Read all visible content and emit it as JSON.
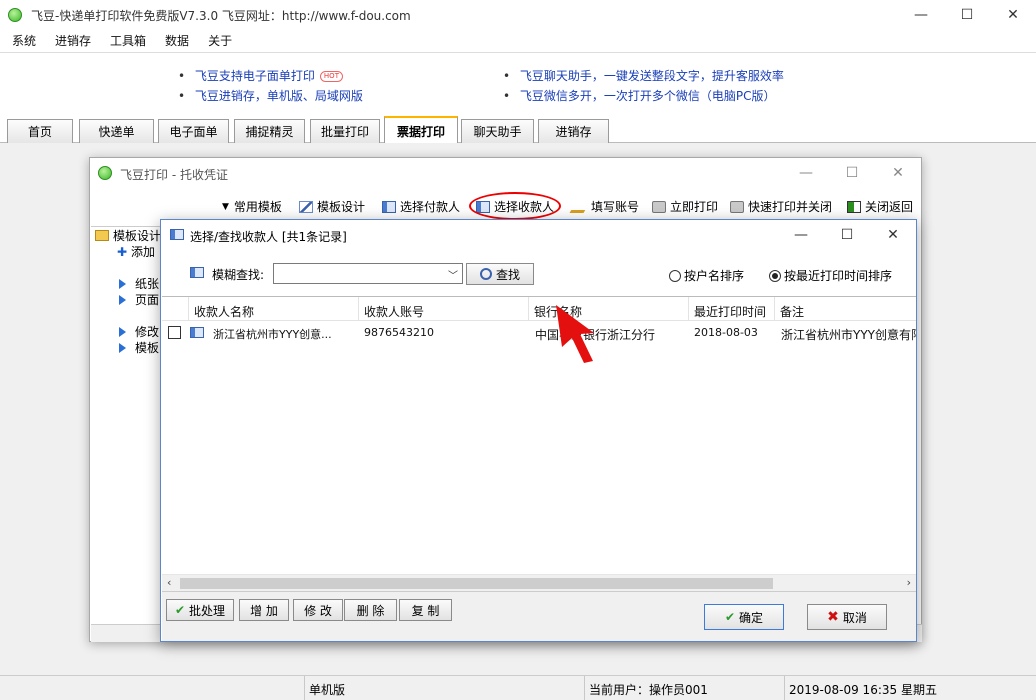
{
  "window": {
    "title": "飞豆-快递单打印软件免费版V7.3.0   飞豆网址：http://www.f-dou.com",
    "controls": {
      "minimize": "—",
      "maximize": "☐",
      "close": "✕"
    }
  },
  "menu": [
    "系统",
    "进销存",
    "工具箱",
    "数据",
    "关于"
  ],
  "ads": [
    {
      "text": "飞豆支持电子面单打印",
      "badge": "HOT"
    },
    {
      "text": "飞豆进销存，单机版、局域网版"
    },
    {
      "text": "飞豆聊天助手，一键发送整段文字，提升客服效率"
    },
    {
      "text": "飞豆微信多开，一次打开多个微信（电脑PC版）"
    }
  ],
  "tabs": [
    {
      "label": "首页",
      "active": false
    },
    {
      "label": "快递单",
      "active": false
    },
    {
      "label": "电子面单",
      "active": false
    },
    {
      "label": "捕捉精灵",
      "active": false
    },
    {
      "label": "批量打印",
      "active": false
    },
    {
      "label": "票据打印",
      "active": true
    },
    {
      "label": "聊天助手",
      "active": false
    },
    {
      "label": "进销存",
      "active": false
    }
  ],
  "voucher_window": {
    "title": "飞豆打印 - 托收凭证",
    "toolbar": [
      {
        "label": "常用模板",
        "icon": "dropdown-triangle"
      },
      {
        "label": "模板设计",
        "icon": "design-icon"
      },
      {
        "label": "选择付款人",
        "icon": "card-icon"
      },
      {
        "label": "选择收款人",
        "icon": "card-icon",
        "highlighted": true
      },
      {
        "label": "填写账号",
        "icon": "pen-icon"
      },
      {
        "label": "立即打印",
        "icon": "printer-icon"
      },
      {
        "label": "快速打印并关闭",
        "icon": "printer-icon"
      },
      {
        "label": "关闭返回",
        "icon": "exit-icon"
      }
    ],
    "tree": [
      {
        "label": "模板设计",
        "kind": "folder"
      },
      {
        "label": "添加",
        "kind": "plus"
      },
      {
        "label": "纸张",
        "kind": "arrow"
      },
      {
        "label": "页面",
        "kind": "arrow"
      },
      {
        "label": "修改",
        "kind": "arrow"
      },
      {
        "label": "模板",
        "kind": "arrow"
      }
    ]
  },
  "dialog": {
    "title": "选择/查找收款人   [共1条记录]",
    "search": {
      "label": "模糊查找:",
      "value": "",
      "button": "查找"
    },
    "sort_options": [
      {
        "label": "按户名排序",
        "selected": false
      },
      {
        "label": "按最近打印时间排序",
        "selected": true
      }
    ],
    "columns": [
      "收款人名称",
      "收款人账号",
      "银行名称",
      "最近打印时间",
      "备注"
    ],
    "rows": [
      {
        "checked": false,
        "name": "浙江省杭州市YYY创意...",
        "account": "9876543210",
        "bank": "中国农业银行浙江分行",
        "last_print": "2018-08-03",
        "note": "浙江省杭州市YYY创意有限"
      }
    ],
    "footer_buttons": [
      "批处理",
      "增 加",
      "修 改",
      "删 除",
      "复 制"
    ],
    "ok": "确定",
    "cancel": "取消"
  },
  "status": {
    "mode": "单机版",
    "user": "当前用户：操作员001",
    "datetime": "2019-08-09 16:35 星期五"
  },
  "colors": {
    "accent": "#1a3fb8",
    "highlight_oval": "#e00000",
    "active_tab_top": "#ffb400"
  }
}
